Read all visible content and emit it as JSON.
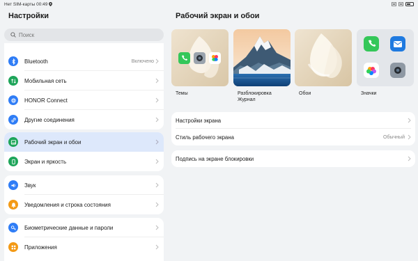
{
  "statusbar": {
    "left_text": "Нет SIM-карты 00:49",
    "icons": [
      "location-icon",
      "wifi-off-icon",
      "sim-icon",
      "battery-icon"
    ]
  },
  "left": {
    "title": "Настройки",
    "search_placeholder": "Поиск",
    "groups": [
      {
        "items": [
          {
            "name": "bluetooth",
            "label": "Bluetooth",
            "value": "Включено",
            "icon": "bluetooth-icon",
            "color": "#2f7df6"
          },
          {
            "name": "mobile-network",
            "label": "Мобильная сеть",
            "value": "",
            "icon": "signal-icon",
            "color": "#1ea55a"
          },
          {
            "name": "honor-connect",
            "label": "HONOR Connect",
            "value": "",
            "icon": "connect-icon",
            "color": "#2f7df6"
          },
          {
            "name": "other-connections",
            "label": "Другие соединения",
            "value": "",
            "icon": "link-icon",
            "color": "#2f7df6"
          }
        ]
      },
      {
        "items": [
          {
            "name": "home-screen-wallpaper",
            "label": "Рабочий экран и обои",
            "value": "",
            "icon": "image-icon",
            "color": "#1ea55a",
            "selected": true
          },
          {
            "name": "display-brightness",
            "label": "Экран и яркость",
            "value": "",
            "icon": "phone-icon",
            "color": "#1ea55a"
          }
        ]
      },
      {
        "items": [
          {
            "name": "sound",
            "label": "Звук",
            "value": "",
            "icon": "speaker-icon",
            "color": "#2f7df6"
          },
          {
            "name": "notifications",
            "label": "Уведомления и строка состояния",
            "value": "",
            "icon": "bell-icon",
            "color": "#f39a16"
          }
        ]
      },
      {
        "items": [
          {
            "name": "biometrics",
            "label": "Биометрические данные и пароли",
            "value": "",
            "icon": "key-icon",
            "color": "#2f7df6"
          },
          {
            "name": "apps",
            "label": "Приложения",
            "value": "",
            "icon": "apps-icon",
            "color": "#f39a16"
          }
        ]
      }
    ]
  },
  "right": {
    "title": "Рабочий экран и обои",
    "thumbs": [
      {
        "name": "themes",
        "label": "Темы"
      },
      {
        "name": "unlock-journal",
        "label": "Разблокировка\nЖурнал"
      },
      {
        "name": "wallpapers",
        "label": "Обои"
      },
      {
        "name": "icons",
        "label": "Значки"
      }
    ],
    "card1": [
      {
        "name": "screen-settings",
        "label": "Настройки экрана",
        "value": ""
      },
      {
        "name": "home-screen-style",
        "label": "Стиль рабочего экрана",
        "value": "Обычный"
      }
    ],
    "card2": [
      {
        "name": "lockscreen-signature",
        "label": "Подпись на экране блокировки",
        "value": ""
      }
    ]
  },
  "colors": {
    "background": "#f1f3f5",
    "selected_row": "#dde8fb",
    "accent_blue": "#2f7df6"
  }
}
